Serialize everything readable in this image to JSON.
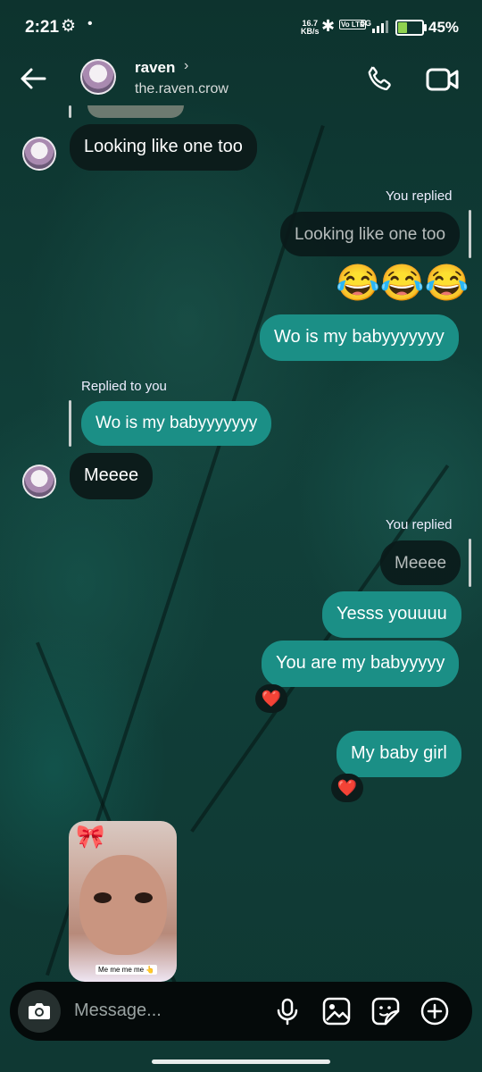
{
  "status_bar": {
    "time": "2:21",
    "speed_value": "16.7",
    "speed_unit": "KB/s",
    "volte": "Vo LTE",
    "network": "5G",
    "battery_percent": "45%",
    "battery_level": 0.45
  },
  "header": {
    "name": "raven",
    "username": "the.raven.crow"
  },
  "messages": [
    {
      "text": "Looking like one too"
    },
    {
      "reply_label": "You replied",
      "quoted": "Looking like one too"
    },
    {
      "emoji": "😂😂😂"
    },
    {
      "text": "Wo is my babyyyyyyy"
    },
    {
      "reply_label": "Replied to you",
      "quoted": "Wo is my babyyyyyyy"
    },
    {
      "text": "Meeee"
    },
    {
      "reply_label": "You replied",
      "quoted": "Meeee"
    },
    {
      "text": "Yesss youuuu"
    },
    {
      "text": "You are my babyyyyy",
      "reaction": "❤️"
    },
    {
      "text": "My baby girl",
      "reaction": "❤️"
    },
    {
      "media_caption": "Me me me me 👆"
    }
  ],
  "composer": {
    "placeholder": "Message..."
  },
  "colors": {
    "outgoing_bubble": "#1b8f86",
    "incoming_bubble": "#0c1c1b",
    "background": "#0f3a33"
  }
}
